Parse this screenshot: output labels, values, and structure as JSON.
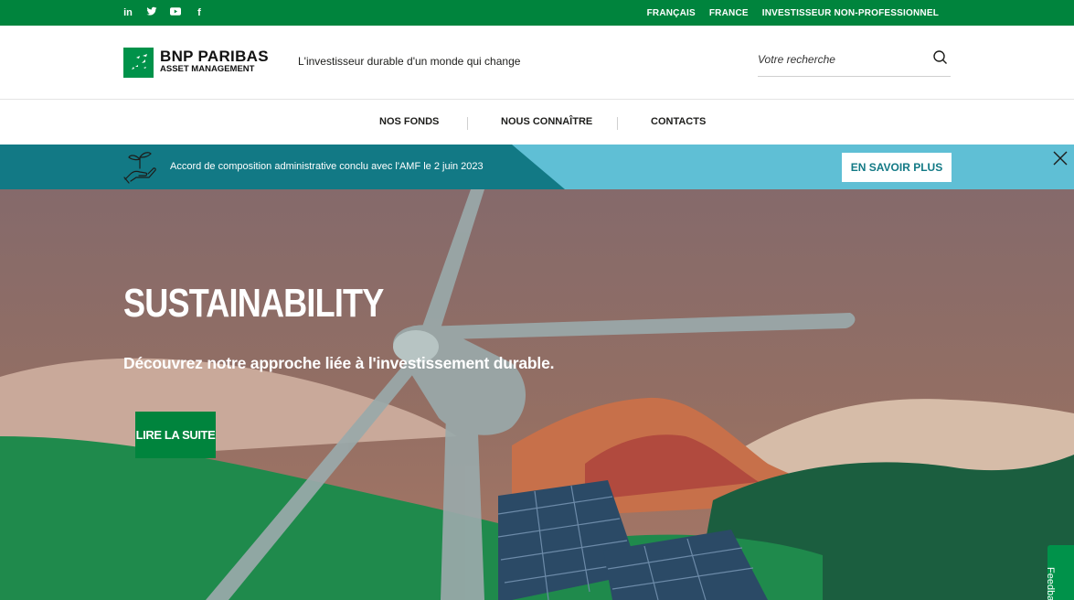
{
  "topbar": {
    "social": [
      "in",
      "t",
      "▶",
      "f"
    ],
    "links": [
      "FRANÇAIS",
      "FRANCE",
      "INVESTISSEUR NON-PROFESSIONNEL"
    ]
  },
  "header": {
    "brand_line1": "BNP PARIBAS",
    "brand_line2": "ASSET MANAGEMENT",
    "tagline": "L'investisseur durable d'un monde qui change",
    "search_placeholder": "Votre recherche"
  },
  "nav": {
    "items": [
      "NOS FONDS",
      "NOUS CONNAÎTRE",
      "CONTACTS"
    ]
  },
  "banner": {
    "message": "Accord de composition administrative conclu avec l'AMF le 2 juin 2023",
    "cta": "EN SAVOIR PLUS"
  },
  "hero": {
    "title": "SUSTAINABILITY",
    "subtitle": "Découvrez notre approche liée à l'investissement durable.",
    "cta": "LIRE LA SUITE"
  },
  "feedback": {
    "label": "Feedback"
  },
  "colors": {
    "brand_green": "#00843d",
    "banner_dark": "#127985",
    "banner_light": "#5fbfd5",
    "hero_sky": "#8a6e6a"
  }
}
